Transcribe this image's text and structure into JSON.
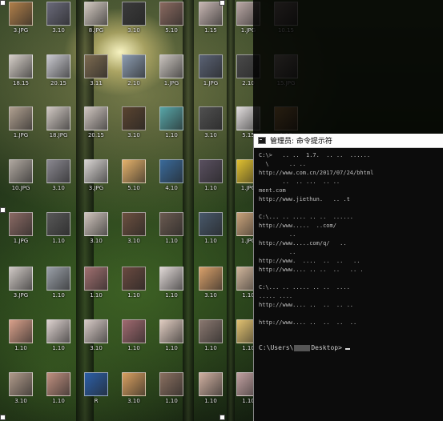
{
  "desktop": {
    "icons": [
      {
        "label": "3.JPG",
        "color": "#b07f4a"
      },
      {
        "label": "3.10",
        "color": "#6a6a7a"
      },
      {
        "label": "8.JPG",
        "color": "#d3c9c0"
      },
      {
        "label": "3.10",
        "color": "#3b3b3b"
      },
      {
        "label": "5.10",
        "color": "#8a6a60"
      },
      {
        "label": "1.15",
        "color": "#c7b6b2"
      },
      {
        "label": "1.JPG",
        "color": "#b9a7a4"
      },
      {
        "label": "10.15",
        "color": "#9c8c86"
      },
      {
        "label": "18.15",
        "color": "#d5cec7"
      },
      {
        "label": "20.15",
        "color": "#c9c9cf"
      },
      {
        "label": "3.11",
        "color": "#7c6a50"
      },
      {
        "label": "2.10",
        "color": "#8c9cb0"
      },
      {
        "label": "1.JPG",
        "color": "#c9c3bd"
      },
      {
        "label": "1.JPG",
        "color": "#5a6274"
      },
      {
        "label": "2.10",
        "color": "#4a4a4a"
      },
      {
        "label": "15.JPG",
        "color": "#a89c92"
      },
      {
        "label": "1.JPG",
        "color": "#b0a090"
      },
      {
        "label": "18.JPG",
        "color": "#d0c8c2"
      },
      {
        "label": "20.15",
        "color": "#cfc5bf"
      },
      {
        "label": "3.10",
        "color": "#5a4430"
      },
      {
        "label": "1.10",
        "color": "#58a6a8"
      },
      {
        "label": "3.10",
        "color": "#505050"
      },
      {
        "label": "5.15",
        "color": "#e0dcdc"
      },
      {
        "label": "1.10",
        "color": "#d5a15b"
      },
      {
        "label": "10.JPG",
        "color": "#b0a8a0"
      },
      {
        "label": "3.10",
        "color": "#8a8890"
      },
      {
        "label": "3.JPG",
        "color": "#d8d4d2"
      },
      {
        "label": "5.10",
        "color": "#e5b26b"
      },
      {
        "label": "4.10",
        "color": "#3a6a9a"
      },
      {
        "label": "1.10",
        "color": "#5a5060"
      },
      {
        "label": "1.JPG",
        "color": "#e0c030"
      },
      {
        "label": "1.10",
        "color": "#9a9090"
      },
      {
        "label": "1.JPG",
        "color": "#8a6a64"
      },
      {
        "label": "1.10",
        "color": "#585858"
      },
      {
        "label": "3.10",
        "color": "#cfc4bc"
      },
      {
        "label": "3.10",
        "color": "#6c5040"
      },
      {
        "label": "1.10",
        "color": "#6a5a50"
      },
      {
        "label": "1.10",
        "color": "#48586a"
      },
      {
        "label": "1.JPG",
        "color": "#c8a27a"
      },
      {
        "label": "1.10",
        "color": "#8a6a5a"
      },
      {
        "label": "3.JPG",
        "color": "#cfc8c4"
      },
      {
        "label": "1.10",
        "color": "#9aa0a8"
      },
      {
        "label": "1.10",
        "color": "#a07070"
      },
      {
        "label": "1.10",
        "color": "#6a4a40"
      },
      {
        "label": "1.10",
        "color": "#e0d8d6"
      },
      {
        "label": "3.10",
        "color": "#d9a06a"
      },
      {
        "label": "1.10",
        "color": "#cfb49a"
      },
      {
        "label": "1.10",
        "color": "#c8c2c8"
      },
      {
        "label": "1.10",
        "color": "#d9a08a"
      },
      {
        "label": "1.10",
        "color": "#ddd2cf"
      },
      {
        "label": "3.10",
        "color": "#d6c9c5"
      },
      {
        "label": "1.10",
        "color": "#a06a70"
      },
      {
        "label": "1.10",
        "color": "#e0ccc0"
      },
      {
        "label": "1.10",
        "color": "#8a7870"
      },
      {
        "label": "1.10",
        "color": "#e0c070"
      },
      {
        "label": "1.10",
        "color": "#d09070"
      },
      {
        "label": "3.10",
        "color": "#b09a8a"
      },
      {
        "label": "1.10",
        "color": "#c09080"
      },
      {
        "label": "R",
        "color": "#2c5fa8"
      },
      {
        "label": "3.10",
        "color": "#d9a060"
      },
      {
        "label": "1.10",
        "color": "#8a7060"
      },
      {
        "label": "1.10",
        "color": "#d0b0a0"
      },
      {
        "label": "1.10",
        "color": "#c0a0a0"
      },
      {
        "label": "1.10",
        "color": "#e0dada"
      }
    ]
  },
  "cmd_window": {
    "title": "管理员: 命令提示符",
    "lines": [
      "C:\\>   .. ..  1.7.  .. ..  ......",
      "  \\      .. ..        ",
      "http://www.com.cn/2017/07/24/bhtml",
      "       ..  .. ...  .. ..    ",
      "ment.com",
      "http://www.jiethun.   .. .t      ",
      "                            ",
      "C:\\... .. .... .. ..  ......   ",
      "http://www.....  ..com/       ",
      "         ..             ",
      "http://www.....com/q/   ..    ",
      "         ..             ",
      "http://www.  ....  ..  ..   ..   ",
      "http://www.... .. ..  ..   .. .",
      "                             ",
      "C:\\... .. ..... .. ..  ....   ",
      "..... ....                  ",
      "http://www.... ..  ..  .. ..  ",
      "                            ",
      "http://www.... ..  ..  ..  ..",
      "                            "
    ],
    "prompt_prefix": "C:\\Users\\",
    "prompt_suffix": "Desktop>"
  }
}
